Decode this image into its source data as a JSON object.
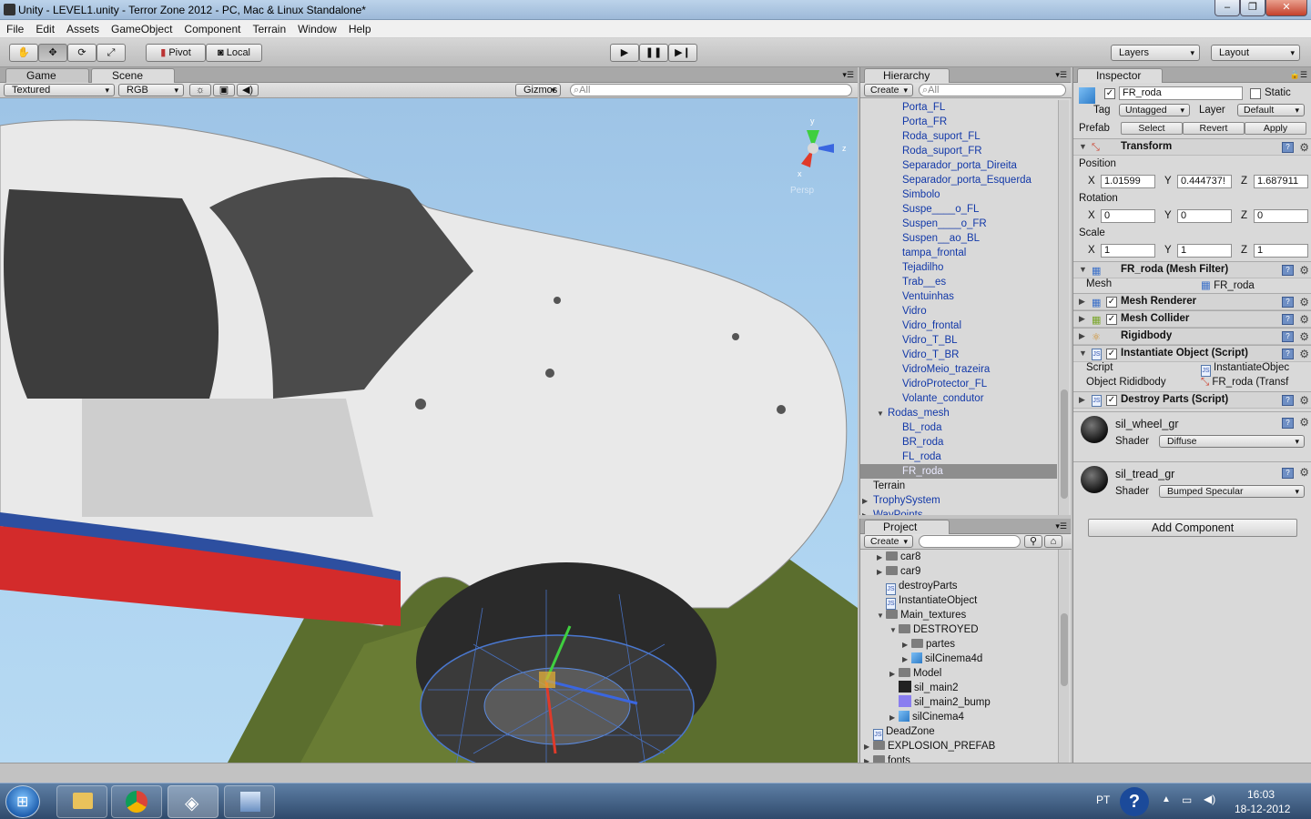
{
  "window": {
    "title": "Unity - LEVEL1.unity - Terror Zone 2012 - PC, Mac & Linux Standalone*",
    "min": "‒",
    "max": "❐",
    "close": "✕"
  },
  "menu": [
    "File",
    "Edit",
    "Assets",
    "GameObject",
    "Component",
    "Terrain",
    "Window",
    "Help"
  ],
  "toolbar": {
    "pivot": "Pivot",
    "local": "Local",
    "layers": "Layers",
    "layout": "Layout"
  },
  "scene": {
    "tab_game": "Game",
    "tab_scene": "Scene",
    "render_mode": "Textured",
    "color_mode": "RGB",
    "gizmos": "Gizmos",
    "search_placeholder": "All",
    "persp_label": "Persp"
  },
  "hierarchy": {
    "title": "Hierarchy",
    "create": "Create",
    "search_placeholder": "All",
    "items": [
      {
        "label": "Porta_FL",
        "indent": 3
      },
      {
        "label": "Porta_FR",
        "indent": 3
      },
      {
        "label": "Roda_suport_FL",
        "indent": 3
      },
      {
        "label": "Roda_suport_FR",
        "indent": 3
      },
      {
        "label": "Separador_porta_Direita",
        "indent": 3
      },
      {
        "label": "Separador_porta_Esquerda",
        "indent": 3
      },
      {
        "label": "Simbolo",
        "indent": 3
      },
      {
        "label": "Suspe____o_FL",
        "indent": 3
      },
      {
        "label": "Suspen____o_FR",
        "indent": 3
      },
      {
        "label": "Suspen__ao_BL",
        "indent": 3
      },
      {
        "label": "tampa_frontal",
        "indent": 3
      },
      {
        "label": "Tejadilho",
        "indent": 3
      },
      {
        "label": "Trab__es",
        "indent": 3
      },
      {
        "label": "Ventuinhas",
        "indent": 3
      },
      {
        "label": "Vidro",
        "indent": 3
      },
      {
        "label": "Vidro_frontal",
        "indent": 3
      },
      {
        "label": "Vidro_T_BL",
        "indent": 3
      },
      {
        "label": "Vidro_T_BR",
        "indent": 3
      },
      {
        "label": "VidroMeio_trazeira",
        "indent": 3
      },
      {
        "label": "VidroProtector_FL",
        "indent": 3
      },
      {
        "label": "Volante_condutor",
        "indent": 3
      },
      {
        "label": "Rodas_mesh",
        "indent": 2,
        "arrow": "▼"
      },
      {
        "label": "BL_roda",
        "indent": 3
      },
      {
        "label": "BR_roda",
        "indent": 3
      },
      {
        "label": "FL_roda",
        "indent": 3
      },
      {
        "label": "FR_roda",
        "indent": 3,
        "selected": true
      },
      {
        "label": "Terrain",
        "indent": 1,
        "black": true
      },
      {
        "label": "TrophySystem",
        "indent": 1,
        "arrow": "▶"
      },
      {
        "label": "WayPoints",
        "indent": 1,
        "arrow": "▶"
      }
    ]
  },
  "project": {
    "title": "Project",
    "create": "Create",
    "items": [
      {
        "label": "car8",
        "indent": 1,
        "icon": "folder",
        "arrow": "▶"
      },
      {
        "label": "car9",
        "indent": 1,
        "icon": "folder",
        "arrow": "▶"
      },
      {
        "label": "destroyParts",
        "indent": 1,
        "icon": "js"
      },
      {
        "label": "InstantiateObject",
        "indent": 1,
        "icon": "js"
      },
      {
        "label": "Main_textures",
        "indent": 1,
        "icon": "folder",
        "arrow": "▼"
      },
      {
        "label": "DESTROYED",
        "indent": 2,
        "icon": "folder",
        "arrow": "▼"
      },
      {
        "label": "partes",
        "indent": 3,
        "icon": "folder",
        "arrow": "▶"
      },
      {
        "label": "silCinema4d",
        "indent": 3,
        "icon": "cube",
        "arrow": "▶"
      },
      {
        "label": "Model",
        "indent": 2,
        "icon": "folder",
        "arrow": "▶"
      },
      {
        "label": "sil_main2",
        "indent": 2,
        "icon": "tex"
      },
      {
        "label": "sil_main2_bump",
        "indent": 2,
        "icon": "bump"
      },
      {
        "label": "silCinema4",
        "indent": 2,
        "icon": "cube",
        "arrow": "▶"
      },
      {
        "label": "DeadZone",
        "indent": 0,
        "icon": "js"
      },
      {
        "label": "EXPLOSION_PREFAB",
        "indent": 0,
        "icon": "folder",
        "arrow": "▶"
      },
      {
        "label": "fonts",
        "indent": 0,
        "icon": "folder",
        "arrow": "▶"
      }
    ]
  },
  "inspector": {
    "title": "Inspector",
    "object_name": "FR_roda",
    "static": "Static",
    "tag_label": "Tag",
    "tag_value": "Untagged",
    "layer_label": "Layer",
    "layer_value": "Default",
    "prefab_label": "Prefab",
    "prefab_select": "Select",
    "prefab_revert": "Revert",
    "prefab_apply": "Apply",
    "transform": {
      "title": "Transform",
      "position_label": "Position",
      "rotation_label": "Rotation",
      "scale_label": "Scale",
      "position": {
        "x": "1.01599",
        "y": "0.444737!",
        "z": "1.687911"
      },
      "rotation": {
        "x": "0",
        "y": "0",
        "z": "0"
      },
      "scale": {
        "x": "1",
        "y": "1",
        "z": "1"
      },
      "x": "X",
      "y": "Y",
      "z": "Z"
    },
    "mesh_filter": {
      "title": "FR_roda (Mesh Filter)",
      "mesh_label": "Mesh",
      "mesh_value": "FR_roda"
    },
    "mesh_renderer": "Mesh Renderer",
    "mesh_collider": "Mesh Collider",
    "rigidbody": "Rigidbody",
    "instantiate": {
      "title": "Instantiate Object (Script)",
      "script_label": "Script",
      "script_value": "InstantiateObjec",
      "rb_label": "Object Rididbody",
      "rb_value": "FR_roda (Transf"
    },
    "destroy": {
      "title": "Destroy Parts (Script)"
    },
    "materials": [
      {
        "name": "sil_wheel_gr",
        "shader_label": "Shader",
        "shader": "Diffuse"
      },
      {
        "name": "sil_tread_gr",
        "shader_label": "Shader",
        "shader": "Bumped Specular"
      }
    ],
    "add_component": "Add Component"
  },
  "taskbar": {
    "lang": "PT",
    "time": "16:03",
    "date": "18-12-2012"
  }
}
